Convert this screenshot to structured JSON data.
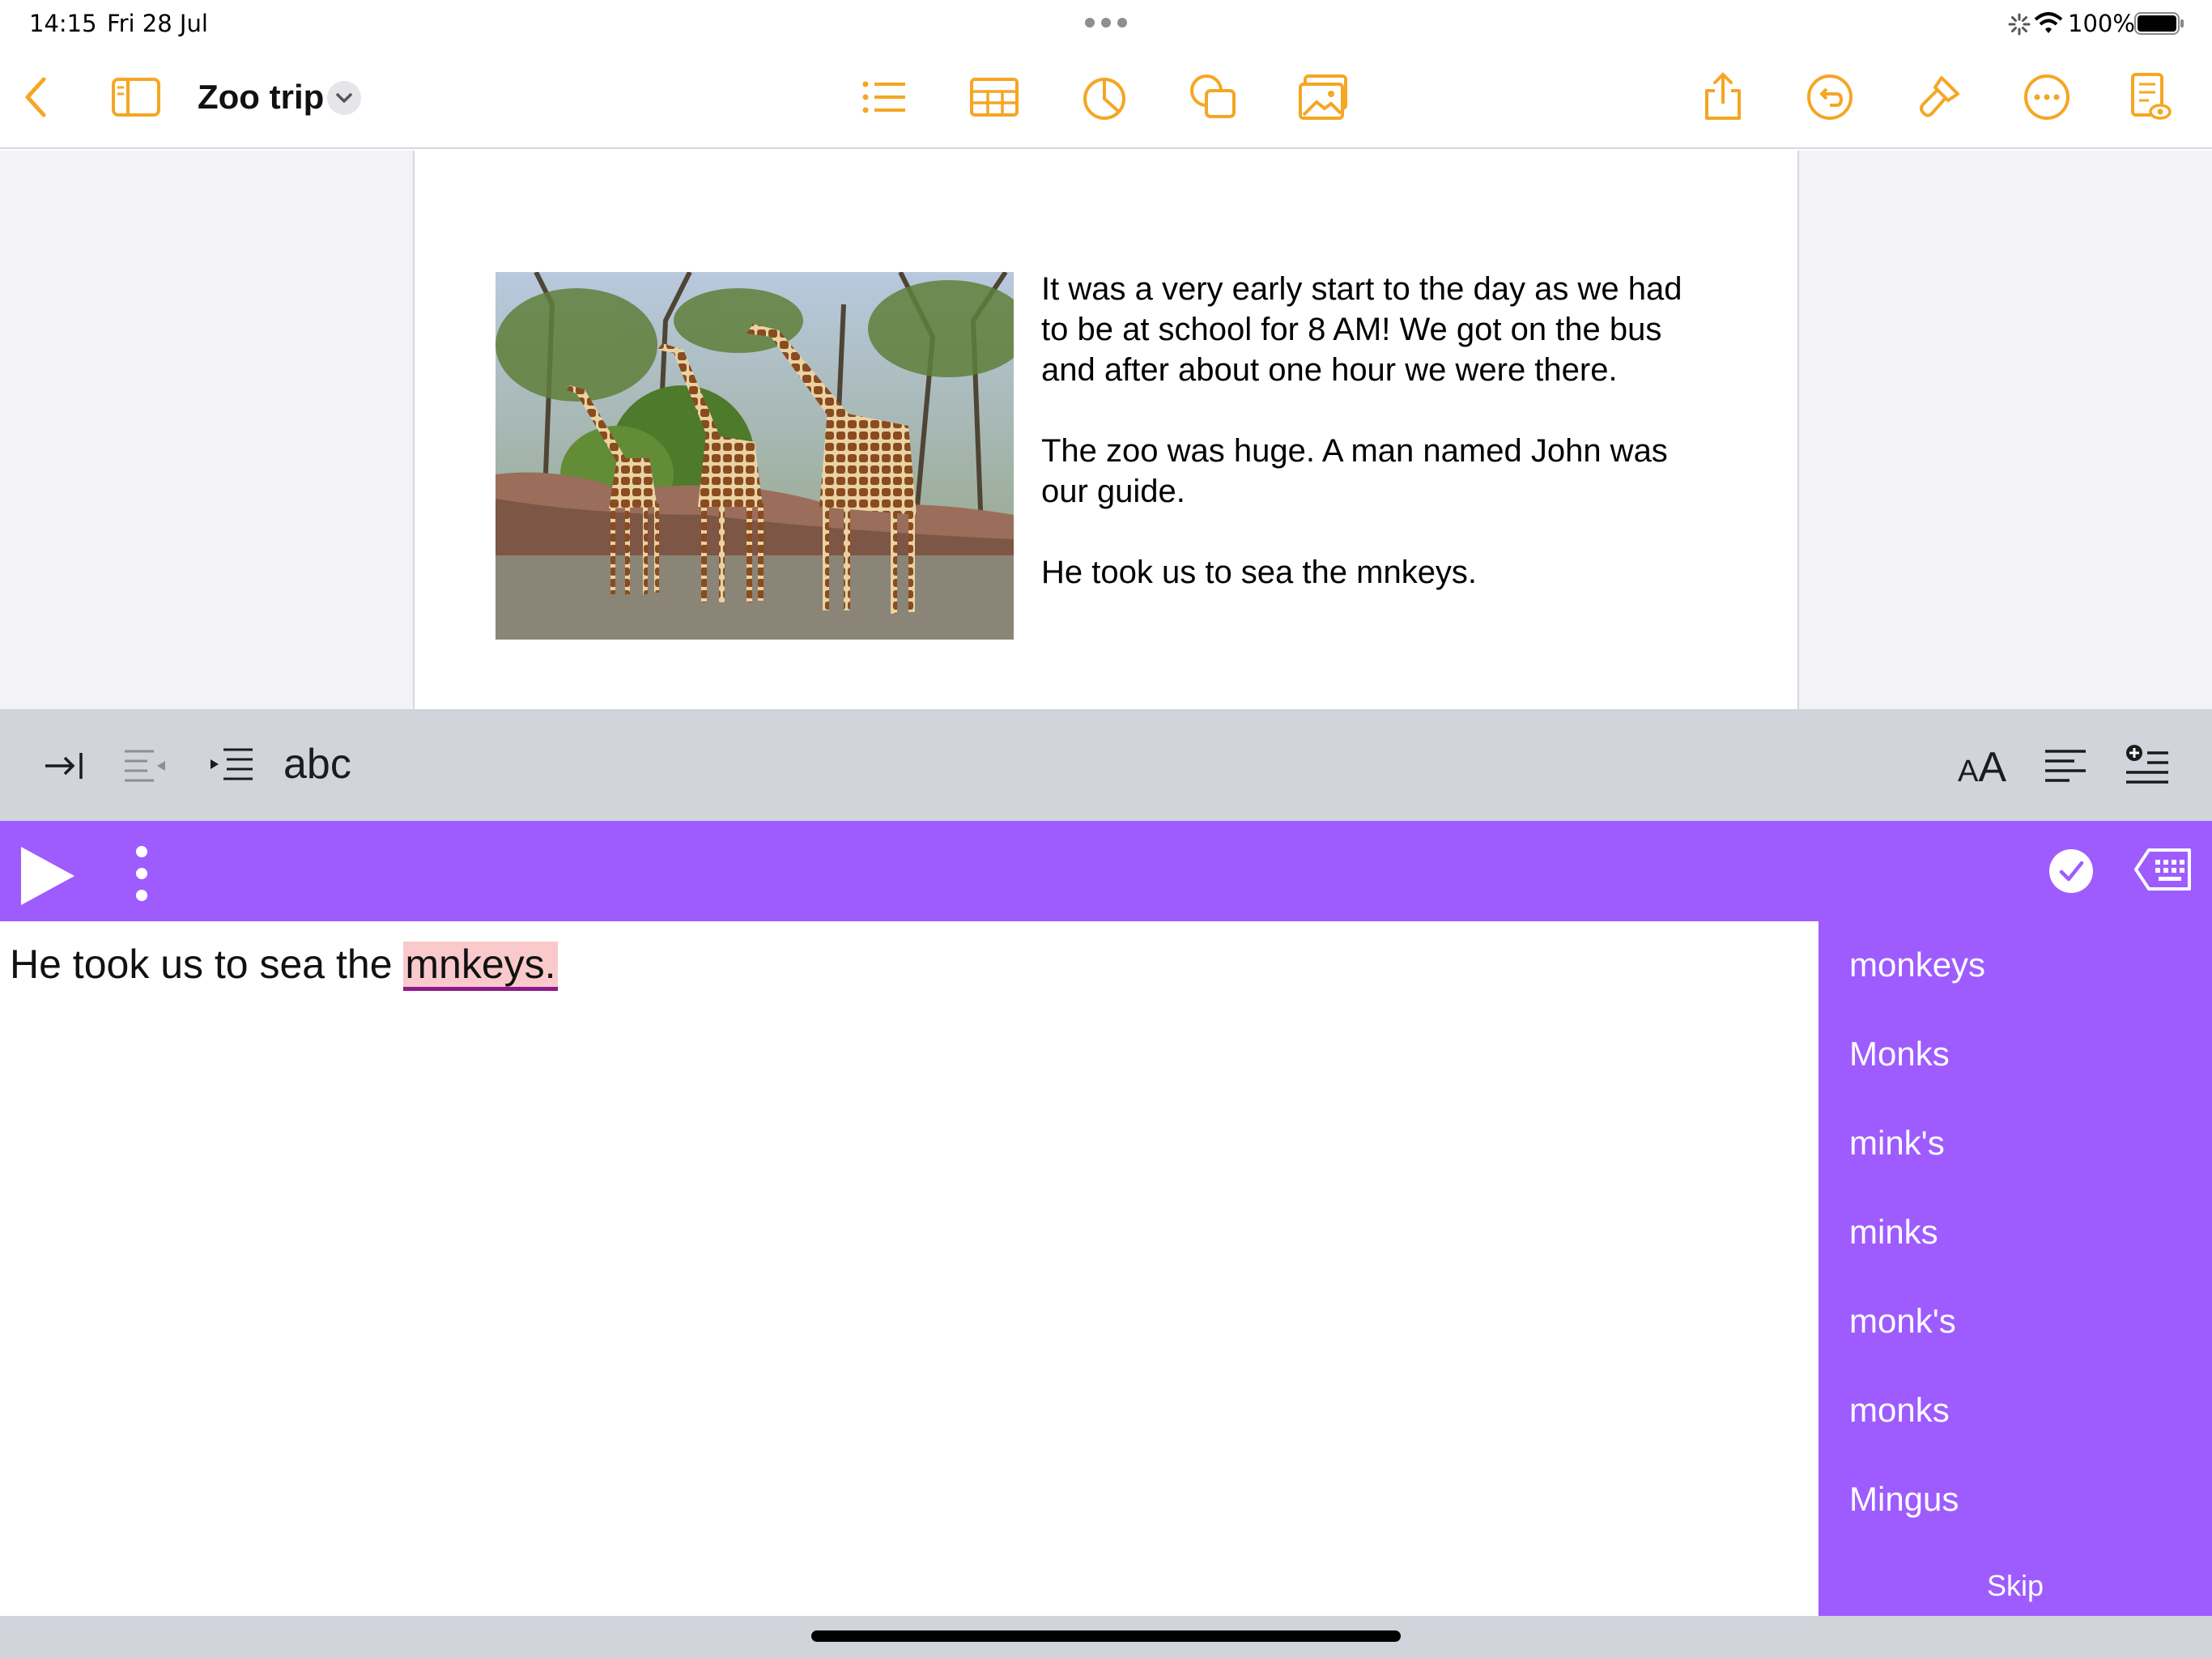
{
  "status": {
    "time": "14:15",
    "date": "Fri 28 Jul",
    "battery": "100%"
  },
  "toolbar": {
    "title": "Zoo trip",
    "accent": "#f5a623",
    "icons_left": [
      "back-chevron-icon",
      "sidebar-icon",
      "title-dropdown-icon"
    ],
    "icons_center": [
      "list-icon",
      "table-icon",
      "chart-icon",
      "shapes-icon",
      "media-icon"
    ],
    "icons_right": [
      "share-icon",
      "undo-icon",
      "paintbrush-icon",
      "more-icon",
      "reading-view-icon"
    ]
  },
  "document": {
    "paragraphs": [
      "It was a very early start to the day as we had to be at school for 8 AM! We got on the bus and after about one hour we were there.",
      "The zoo was huge. A man named John was our guide.",
      "He took us to sea the mnkeys."
    ],
    "image": "giraffes-photo"
  },
  "formatbar": {
    "abc_label": "abc",
    "aa_small": "A",
    "aa_big": "A",
    "icons": [
      "tab-icon",
      "outdent-icon",
      "indent-icon",
      "font-size-icon",
      "align-icon",
      "insert-list-icon"
    ]
  },
  "spellcheck": {
    "accent": "#9e5cff",
    "sentence_before": "He took us to sea the ",
    "misspelled_word": "mnkeys.",
    "suggestions": [
      "monkeys",
      "Monks",
      "mink's",
      "minks",
      "monk's",
      "monks",
      "Mingus"
    ],
    "skip_label": "Skip"
  }
}
